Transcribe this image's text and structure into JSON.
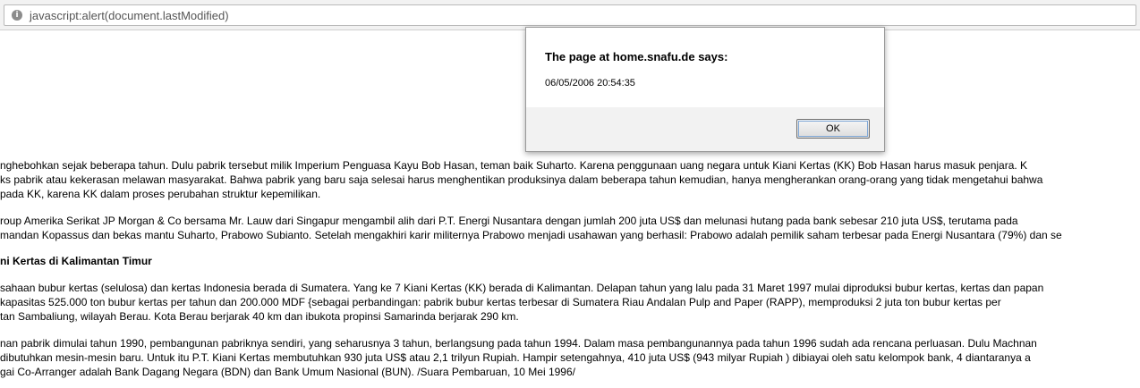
{
  "browser": {
    "url": "javascript:alert(document.lastModified)",
    "url_icon": "info-icon"
  },
  "page": {
    "paragraphs": [
      {
        "lines": [
          "nghebohkan sejak beberapa tahun. Dulu pabrik tersebut milik Imperium Penguasa Kayu Bob Hasan, teman baik Suharto. Karena penggunaan uang negara untuk Kiani Kertas (KK) Bob Hasan harus masuk penjara. K",
          "ks pabrik atau kekerasan melawan masyarakat. Bahwa pabrik yang baru saja selesai harus menghentikan produksinya dalam beberapa tahun kemudian, hanya mengherankan orang-orang yang tidak mengetahui bahwa",
          " pada KK, karena KK dalam proses perubahan struktur kepemilikan."
        ]
      },
      {
        "lines": [
          "roup Amerika Serikat JP Morgan & Co bersama Mr. Lauw dari Singapur mengambil alih dari P.T. Energi Nusantara dengan jumlah 200 juta US$ dan melunasi hutang pada bank sebesar 210 juta US$, terutama pada",
          "mandan Kopassus dan bekas mantu Suharto, Prabowo Subianto. Setelah mengakhiri karir militernya Prabowo menjadi usahawan yang berhasil: Prabowo adalah pemilik saham terbesar pada Energi Nusantara (79%) dan se"
        ]
      },
      {
        "heading": true,
        "lines": [
          "ni Kertas di Kalimantan Timur"
        ]
      },
      {
        "lines": [
          "sahaan bubur kertas (selulosa) dan kertas Indonesia berada di Sumatera. Yang ke 7 Kiani Kertas (KK) berada di Kalimantan. Delapan tahun yang lalu pada 31 Maret 1997 mulai diproduksi bubur kertas, kertas dan papan",
          " kapasitas 525.000 ton bubur kertas per tahun dan 200.000 MDF {sebagai perbandingan: pabrik bubur kertas terbesar di Sumatera Riau Andalan Pulp and Paper (RAPP), memproduksi 2 juta ton bubur kertas per",
          "tan Sambaliung, wilayah Berau. Kota Berau berjarak 40 km dan ibukota propinsi Samarinda berjarak 290 km."
        ]
      },
      {
        "lines": [
          "nan pabrik dimulai tahun 1990, pembangunan pabriknya sendiri, yang seharusnya 3 tahun, berlangsung pada tahun 1994. Dalam masa pembangunannya pada tahun 1996 sudah ada rencana perluasan. Dulu Machnan",
          " dibutuhkan mesin-mesin baru. Untuk itu P.T. Kiani Kertas membutuhkan 930 juta US$ atau 2,1 trilyun Rupiah. Hampir setengahnya, 410 juta US$ (943 milyar Rupiah ) dibiayai oleh satu kelompok bank, 4 diantaranya a",
          "gai Co-Arranger adalah Bank Dagang Negara (BDN) dan Bank Umum Nasional (BUN). /Suara Pembaruan, 10 Mei 1996/"
        ]
      }
    ]
  },
  "dialog": {
    "title": "The page at home.snafu.de says:",
    "message": "06/05/2006 20:54:35",
    "ok_label": "OK"
  }
}
